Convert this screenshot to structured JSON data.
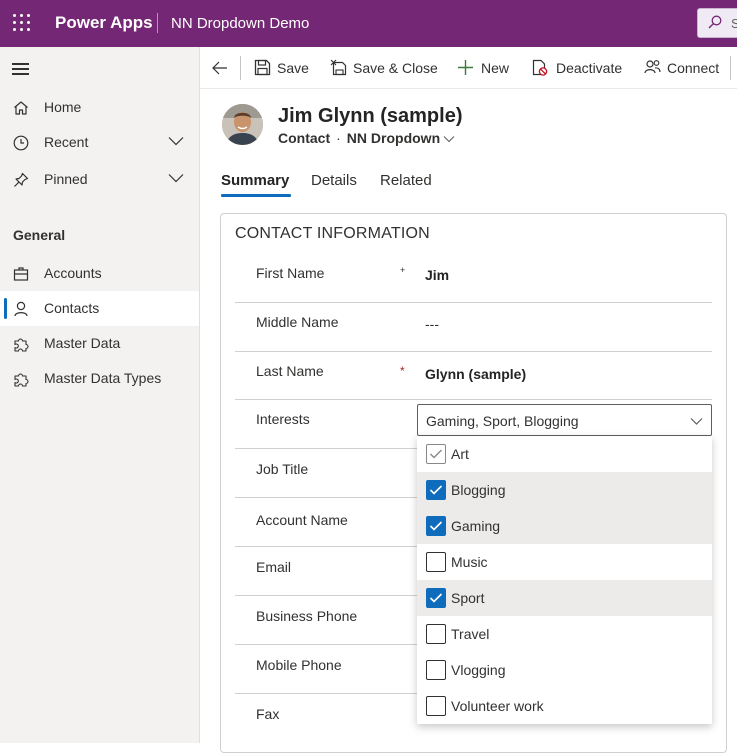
{
  "topbar": {
    "app_name": "Power Apps",
    "app_title": "NN Dropdown Demo",
    "search_placeholder": "Se"
  },
  "nav": {
    "items": [
      {
        "label": "Home"
      },
      {
        "label": "Recent"
      },
      {
        "label": "Pinned"
      }
    ],
    "section_title": "General",
    "section_items": [
      {
        "label": "Accounts"
      },
      {
        "label": "Contacts"
      },
      {
        "label": "Master Data"
      },
      {
        "label": "Master Data Types"
      }
    ],
    "active_item": "Contacts"
  },
  "commands": {
    "save": "Save",
    "save_close": "Save & Close",
    "new": "New",
    "deactivate": "Deactivate",
    "connect": "Connect"
  },
  "record": {
    "title": "Jim Glynn (sample)",
    "entity": "Contact",
    "separator": "·",
    "form_name": "NN Dropdown"
  },
  "tabs": [
    {
      "label": "Summary",
      "active": true
    },
    {
      "label": "Details",
      "active": false
    },
    {
      "label": "Related",
      "active": false
    }
  ],
  "section": {
    "title": "CONTACT INFORMATION",
    "fields": {
      "first_name": {
        "label": "First Name",
        "value": "Jim",
        "marker": "+"
      },
      "middle_name": {
        "label": "Middle Name",
        "value": "---"
      },
      "last_name": {
        "label": "Last Name",
        "value": "Glynn (sample)",
        "marker": "*"
      },
      "interests": {
        "label": "Interests",
        "value": "Gaming, Sport, Blogging"
      },
      "job_title": {
        "label": "Job Title"
      },
      "account_name": {
        "label": "Account Name"
      },
      "email": {
        "label": "Email"
      },
      "business_phone": {
        "label": "Business Phone"
      },
      "mobile_phone": {
        "label": "Mobile Phone"
      },
      "fax": {
        "label": "Fax"
      }
    }
  },
  "interests_options": [
    {
      "label": "Art",
      "checked": false,
      "focused": true
    },
    {
      "label": "Blogging",
      "checked": true
    },
    {
      "label": "Gaming",
      "checked": true
    },
    {
      "label": "Music",
      "checked": false
    },
    {
      "label": "Sport",
      "checked": true
    },
    {
      "label": "Travel",
      "checked": false
    },
    {
      "label": "Vlogging",
      "checked": false
    },
    {
      "label": "Volunteer work",
      "checked": false
    }
  ],
  "colors": {
    "header": "#742774",
    "accent": "#0f6cbd",
    "required": "#a4262c"
  }
}
